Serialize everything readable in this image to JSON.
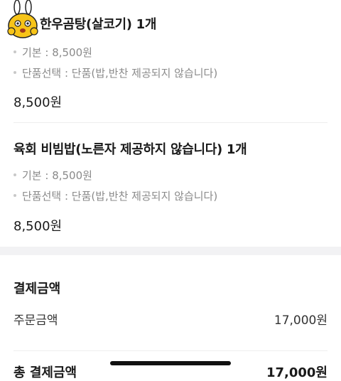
{
  "items": [
    {
      "title": "한우곰탕(살코기) 1개",
      "options": [
        "기본 : 8,500원",
        "단품선택 : 단품(밥,반찬 제공되지 않습니다)"
      ],
      "price": "8,500원"
    },
    {
      "title": "육회 비빔밥(노른자 제공하지 않습니다) 1개",
      "options": [
        "기본 : 8,500원",
        "단품선택 : 단품(밥,반찬 제공되지 않습니다)"
      ],
      "price": "8,500원"
    }
  ],
  "payment": {
    "section_title": "결제금액",
    "order_amount_label": "주문금액",
    "order_amount_value": "17,000원",
    "total_label": "총 결제금액",
    "total_value": "17,000원"
  },
  "icons": {
    "mascot": "yellow-mascot-icon"
  },
  "colors": {
    "band": "#f2f2f4",
    "option_text": "#8a8a8a"
  }
}
